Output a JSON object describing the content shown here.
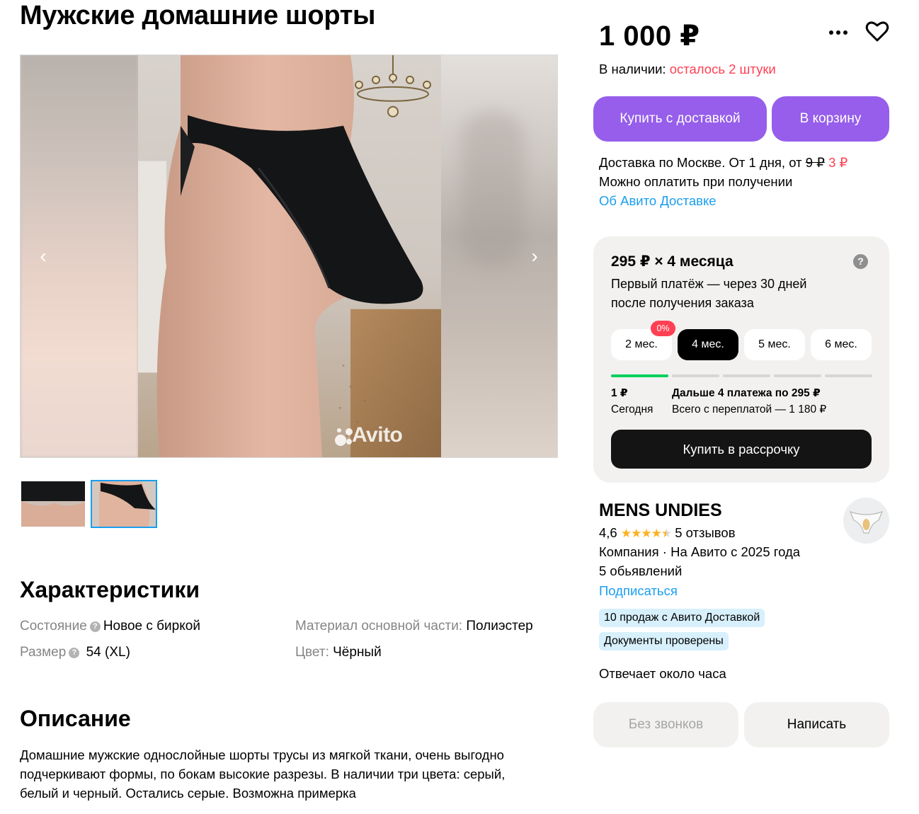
{
  "product": {
    "title": "Мужские домашние шорты",
    "price": "1 000 ₽"
  },
  "gallery": {
    "watermark": "Avito",
    "thumbnails_count": 2,
    "active_thumbnail": 2
  },
  "availability": {
    "label": "В наличии:",
    "remaining": "осталось 2 штуки"
  },
  "actions": {
    "buy_delivery": "Купить с доставкой",
    "add_to_cart": "В корзину"
  },
  "delivery": {
    "line1_prefix": "Доставка по Москве. От 1 дня, от",
    "old_price": "9 ₽",
    "new_price": "3 ₽",
    "line2": "Можно оплатить при получении",
    "about_link": "Об Авито Доставке"
  },
  "installment": {
    "title": "295 ₽ × 4 месяца",
    "help_icon": "?",
    "subtitle": "Первый платёж — через 30 дней после получения заказа",
    "terms": [
      {
        "label": "2 мес.",
        "badge": "0%"
      },
      {
        "label": "4 мес."
      },
      {
        "label": "5 мес."
      },
      {
        "label": "6 мес."
      }
    ],
    "active_term": 1,
    "today_amount": "1 ₽",
    "today_label": "Сегодня",
    "further": "Дальше 4 платежа по 295 ₽",
    "total": "Всего с переплатой — 1 180 ₽",
    "buy_button": "Купить в рассрочку"
  },
  "seller": {
    "name": "MENS UNDIES",
    "rating": "4,6",
    "rating_stars": 4.5,
    "reviews": "5 отзывов",
    "type_since": "Компания · На Авито с 2025 года",
    "listings": "5 обьявлений",
    "subscribe": "Подписаться",
    "badges": [
      "10 продаж с Авито Доставкой",
      "Документы проверены"
    ],
    "response": "Отвечает около часа"
  },
  "contact": {
    "no_calls": "Без звонков",
    "write": "Написать"
  },
  "specs": {
    "heading": "Характеристики",
    "condition_key": "Состояние",
    "condition_val": "Новое с биркой",
    "size_key": "Размер",
    "size_val": "54 (XL)",
    "material_key": "Материал основной части:",
    "material_val": "Полиэстер",
    "color_key": "Цвет:",
    "color_val": "Чёрный"
  },
  "description": {
    "heading": "Описание",
    "text": "Домашние мужские однослойные шорты трусы из мягкой ткани, очень выгодно подчеркивают формы, по бокам высокие разрезы. В наличии три цвета: серый, белый и черный. Остались серые. Возможна примерка"
  },
  "colors": {
    "accent_violet": "#965eeb",
    "link_blue": "#1a9ef0",
    "alert_red": "#ff4053",
    "progress_green": "#02d15c",
    "badge_blue": "#d7f0fc"
  }
}
